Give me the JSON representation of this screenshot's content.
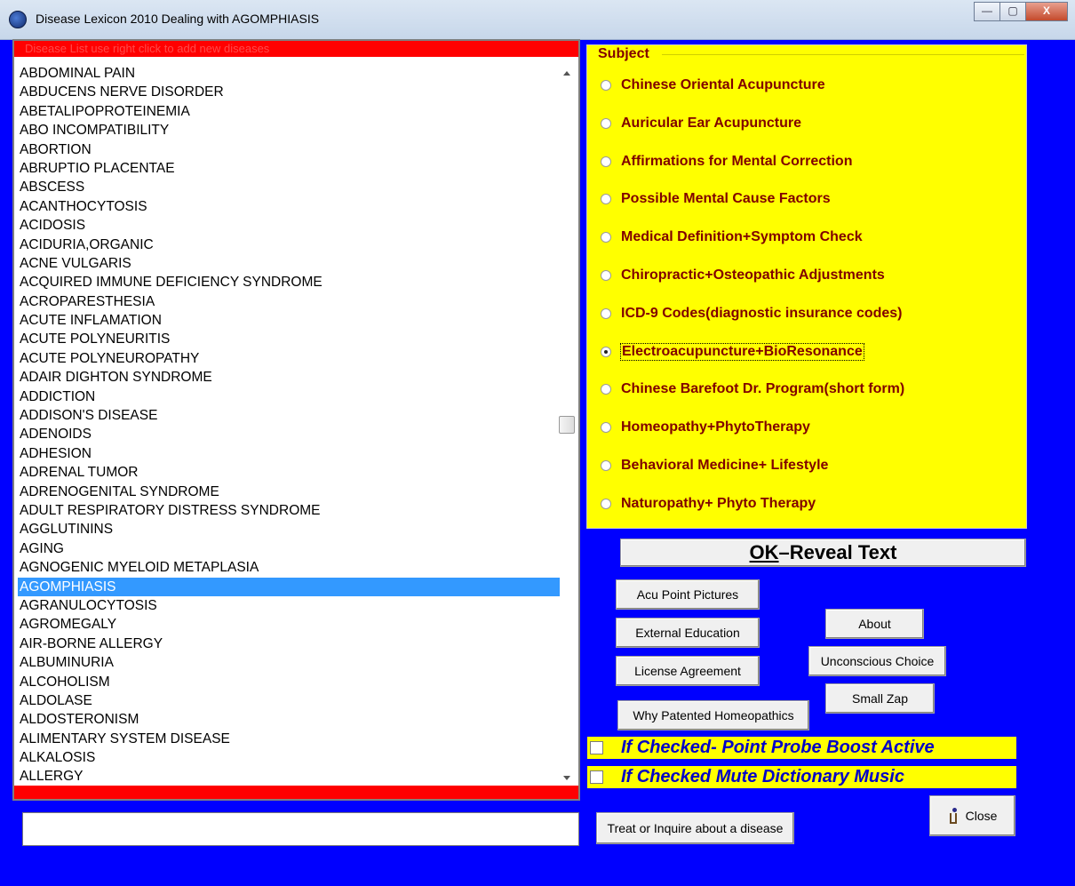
{
  "window": {
    "title": "Disease Lexicon 2010 Dealing with AGOMPHIASIS",
    "minimize": "—",
    "maximize": "▢",
    "close": "X"
  },
  "list": {
    "header": "Disease List use right click to add new diseases",
    "selected": "AGOMPHIASIS",
    "items": [
      "ABDOMINAL PAIN",
      "ABDUCENS NERVE DISORDER",
      "ABETALIPOPROTEINEMIA",
      "ABO INCOMPATIBILITY",
      "ABORTION",
      "ABRUPTIO PLACENTAE",
      "ABSCESS",
      "ACANTHOCYTOSIS",
      "ACIDOSIS",
      "ACIDURIA,ORGANIC",
      "ACNE VULGARIS",
      "ACQUIRED IMMUNE DEFICIENCY SYNDROME",
      "ACROPARESTHESIA",
      "ACUTE INFLAMATION",
      "ACUTE POLYNEURITIS",
      "ACUTE POLYNEUROPATHY",
      "ADAIR DIGHTON SYNDROME",
      "ADDICTION",
      "ADDISON'S DISEASE",
      "ADENOIDS",
      "ADHESION",
      "ADRENAL TUMOR",
      "ADRENOGENITAL SYNDROME",
      "ADULT RESPIRATORY DISTRESS SYNDROME",
      "AGGLUTININS",
      "AGING",
      "AGNOGENIC MYELOID METAPLASIA",
      "AGOMPHIASIS",
      "AGRANULOCYTOSIS",
      "AGROMEGALY",
      "AIR-BORNE ALLERGY",
      "ALBUMINURIA",
      "ALCOHOLISM",
      "ALDOLASE",
      "ALDOSTERONISM",
      "ALIMENTARY SYSTEM DISEASE",
      "ALKALOSIS",
      "ALLERGY"
    ]
  },
  "input": {
    "value": ""
  },
  "subject": {
    "title": "Subject",
    "selected_index": 7,
    "options": [
      "Chinese Oriental Acupuncture",
      "Auricular Ear Acupuncture",
      "Affirmations for Mental Correction",
      "Possible Mental Cause Factors",
      "Medical Definition+Symptom Check",
      "Chiropractic+Osteopathic Adjustments",
      "ICD-9 Codes(diagnostic insurance codes)",
      "Electroacupuncture+BioResonance",
      "Chinese Barefoot Dr. Program(short form)",
      "Homeopathy+PhytoTherapy",
      "Behavioral Medicine+ Lifestyle",
      "Naturopathy+ Phyto Therapy"
    ]
  },
  "buttons": {
    "ok_key": "OK",
    "ok_rest": " –Reveal Text",
    "acu_point": "Acu Point Pictures",
    "external_education": "External Education",
    "license": "License Agreement",
    "why_patented": "Why Patented Homeopathics",
    "about": "About",
    "unconscious": "Unconscious Choice",
    "small_zap": "Small Zap",
    "treat": "Treat or Inquire about a disease",
    "close": "Close"
  },
  "checkboxes": {
    "probe_boost": "If Checked- Point Probe Boost Active",
    "mute_music": "If Checked Mute Dictionary Music",
    "probe_boost_checked": false,
    "mute_music_checked": false
  },
  "colors": {
    "background": "#0000ff",
    "subject_bg": "#ffff00",
    "subject_text": "#800000",
    "list_header": "#ff0000",
    "selection": "#3399ff",
    "checkbox_text": "#0000c8"
  }
}
